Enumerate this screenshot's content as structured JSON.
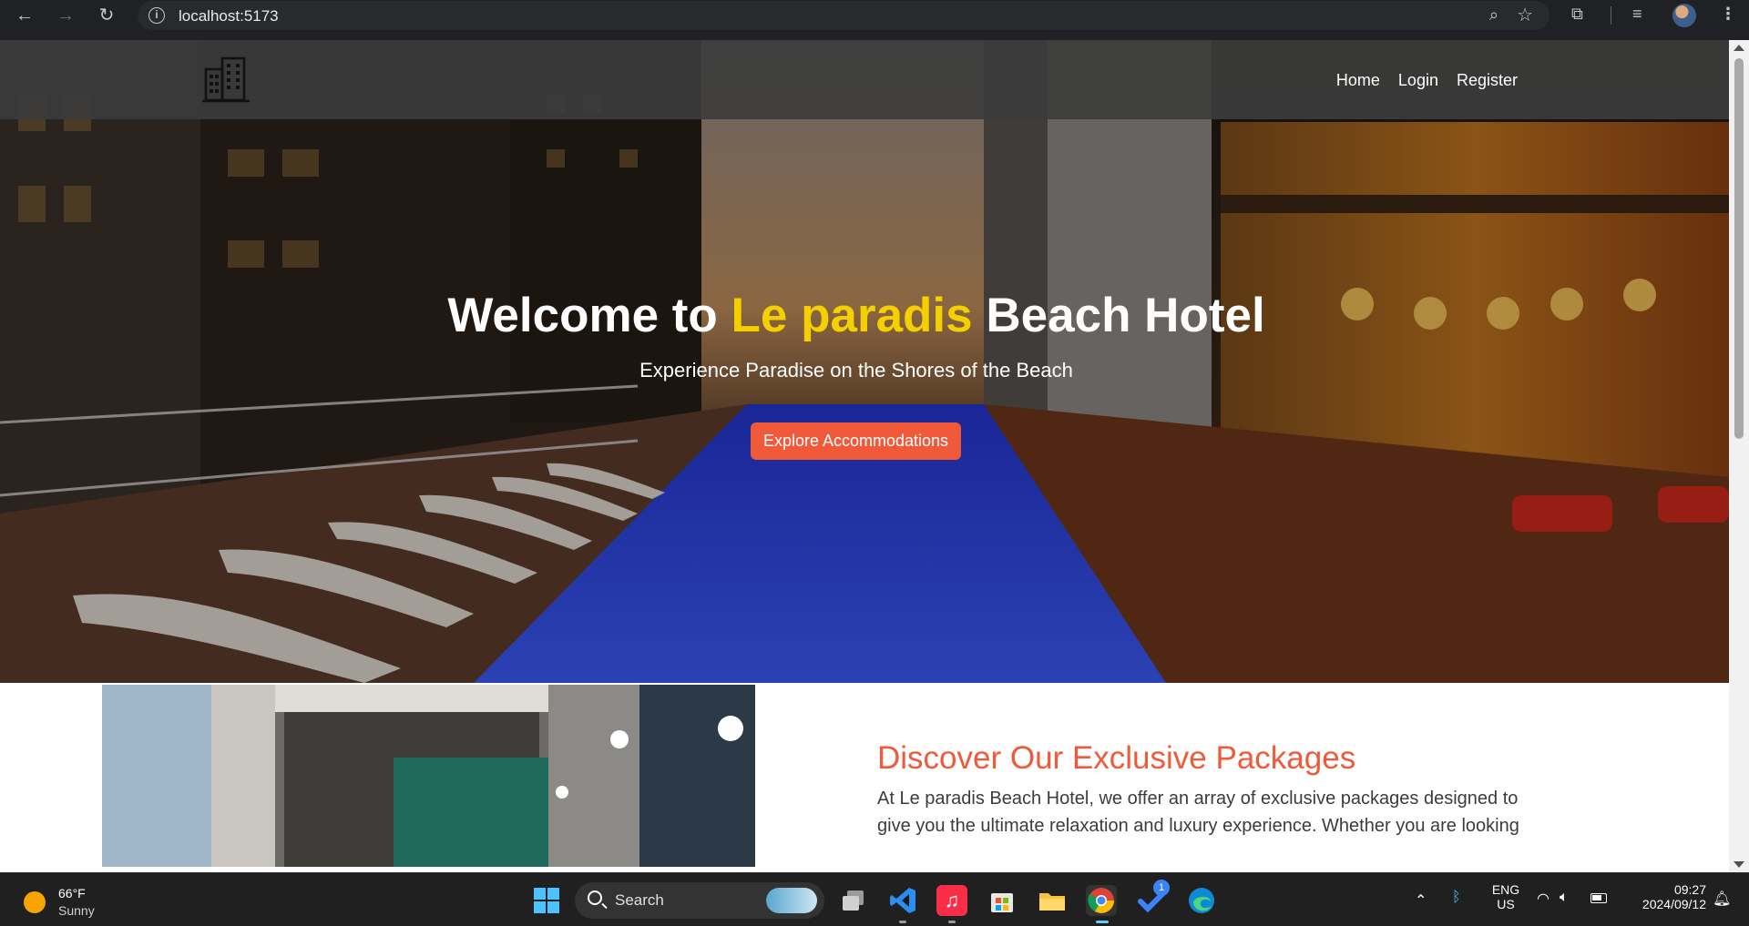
{
  "browser": {
    "url": "localhost:5173",
    "back_icon": "back-arrow-icon",
    "forward_icon": "forward-arrow-icon",
    "reload_icon": "reload-icon"
  },
  "site": {
    "nav": {
      "home": "Home",
      "login": "Login",
      "register": "Register"
    },
    "hero": {
      "title_prefix": "Welcome to ",
      "title_accent": "Le paradis",
      "title_suffix": " Beach Hotel",
      "subtitle": "Experience Paradise on the Shores of the Beach",
      "cta": "Explore Accommodations"
    },
    "packages": {
      "title": "Discover Our Exclusive Packages",
      "text": "At Le paradis Beach Hotel, we offer an array of exclusive packages designed to give you the ultimate relaxation and luxury experience. Whether you are looking"
    },
    "colors": {
      "accent_yellow": "#f5d000",
      "accent_orange": "#f05a3a"
    }
  },
  "taskbar": {
    "weather_temp": "66°F",
    "weather_cond": "Sunny",
    "search_label": "Search",
    "lang_top": "ENG",
    "lang_bottom": "US",
    "time": "09:27",
    "date": "2024/09/12",
    "todo_badge": "1"
  }
}
